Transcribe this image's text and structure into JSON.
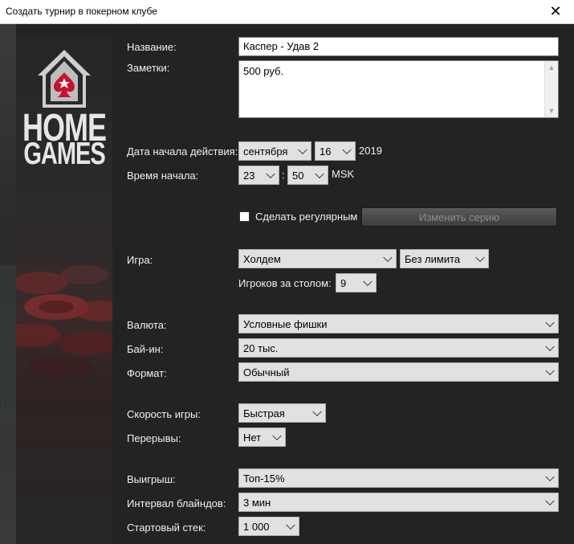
{
  "window": {
    "title": "Создать турнир в покерном клубе",
    "close_glyph": "✕"
  },
  "logo": {
    "line1": "HOME",
    "line2": "GAMES"
  },
  "form": {
    "name": {
      "label": "Название:",
      "value": "Каспер - Удав 2"
    },
    "notes": {
      "label": "Заметки:",
      "value": "500 руб."
    },
    "start_date": {
      "label": "Дата начала действия:",
      "month": "сентября",
      "day": "16",
      "year": "2019"
    },
    "start_time": {
      "label": "Время начала:",
      "hour": "23",
      "separator": ":",
      "minute": "50",
      "timezone": "MSK"
    },
    "recurring": {
      "label": "Сделать регулярным",
      "checked": false,
      "button_label": "Изменить серию"
    },
    "game": {
      "label": "Игра:",
      "value": "Холдем",
      "limit": "Без лимита",
      "players_label": "Игроков за столом:",
      "players": "9"
    },
    "currency": {
      "label": "Валюта:",
      "value": "Условные фишки"
    },
    "buyin": {
      "label": "Бай-ин:",
      "value": "20 тыс."
    },
    "format": {
      "label": "Формат:",
      "value": "Обычный"
    },
    "speed": {
      "label": "Скорость игры:",
      "value": "Быстрая"
    },
    "breaks": {
      "label": "Перерывы:",
      "value": "Нет"
    },
    "payout": {
      "label": "Выигрыш:",
      "value": "Топ-15%"
    },
    "blind_interval": {
      "label": "Интервал блайндов:",
      "value": "3 мин"
    },
    "starting_stack": {
      "label": "Стартовый стек:",
      "value": "1 000"
    }
  },
  "colors": {
    "background": "#232323",
    "logo_suit": "#c8102e",
    "text": "#f0f0f0"
  }
}
